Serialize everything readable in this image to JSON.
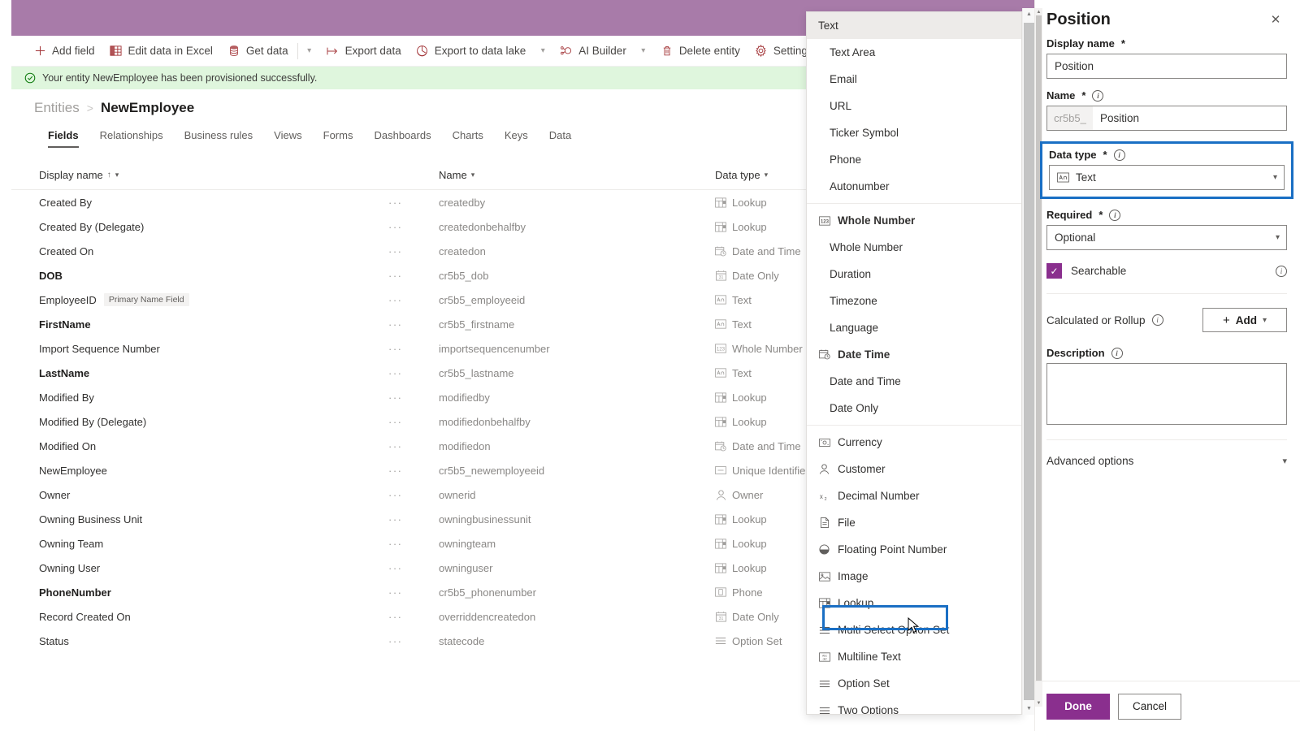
{
  "theme": {
    "accent": "#8a2f8e",
    "header_bar": "#a87ba9",
    "focus_outline": "#1a6fc4",
    "success_bg": "#dff6dd"
  },
  "commandbar": {
    "items": [
      {
        "label": "Add field",
        "icon": "plus-icon",
        "chevron": false
      },
      {
        "label": "Edit data in Excel",
        "icon": "excel-icon",
        "chevron": false
      },
      {
        "label": "Get data",
        "icon": "database-icon",
        "chevron": true
      },
      {
        "label": "Export data",
        "icon": "export-icon",
        "chevron": false
      },
      {
        "label": "Export to data lake",
        "icon": "datalake-icon",
        "chevron": true
      },
      {
        "label": "AI Builder",
        "icon": "ai-builder-icon",
        "chevron": true
      },
      {
        "label": "Delete entity",
        "icon": "trash-icon",
        "chevron": false
      },
      {
        "label": "Settings",
        "icon": "gear-icon",
        "chevron": false
      }
    ]
  },
  "notification": {
    "text": "Your entity NewEmployee has been provisioned successfully.",
    "icon": "success-check-icon"
  },
  "breadcrumb": {
    "root": "Entities",
    "separator": ">",
    "current": "NewEmployee"
  },
  "tabs": {
    "items": [
      "Fields",
      "Relationships",
      "Business rules",
      "Views",
      "Forms",
      "Dashboards",
      "Charts",
      "Keys",
      "Data"
    ],
    "active": "Fields"
  },
  "table": {
    "columns": {
      "display_name": "Display name",
      "name": "Name",
      "data_type": "Data type",
      "sort_indicator": "↑"
    },
    "rows": [
      {
        "display": "Created By",
        "bold": false,
        "badge": "",
        "name": "createdby",
        "type": "Lookup",
        "type_icon": "lookup-icon"
      },
      {
        "display": "Created By (Delegate)",
        "bold": false,
        "badge": "",
        "name": "createdonbehalfby",
        "type": "Lookup",
        "type_icon": "lookup-icon"
      },
      {
        "display": "Created On",
        "bold": false,
        "badge": "",
        "name": "createdon",
        "type": "Date and Time",
        "type_icon": "datetime-icon"
      },
      {
        "display": "DOB",
        "bold": true,
        "badge": "",
        "name": "cr5b5_dob",
        "type": "Date Only",
        "type_icon": "dateonly-icon"
      },
      {
        "display": "EmployeeID",
        "bold": false,
        "badge": "Primary Name Field",
        "name": "cr5b5_employeeid",
        "type": "Text",
        "type_icon": "text-icon"
      },
      {
        "display": "FirstName",
        "bold": true,
        "badge": "",
        "name": "cr5b5_firstname",
        "type": "Text",
        "type_icon": "text-icon"
      },
      {
        "display": "Import Sequence Number",
        "bold": false,
        "badge": "",
        "name": "importsequencenumber",
        "type": "Whole Number",
        "type_icon": "wholenumber-icon"
      },
      {
        "display": "LastName",
        "bold": true,
        "badge": "",
        "name": "cr5b5_lastname",
        "type": "Text",
        "type_icon": "text-icon"
      },
      {
        "display": "Modified By",
        "bold": false,
        "badge": "",
        "name": "modifiedby",
        "type": "Lookup",
        "type_icon": "lookup-icon"
      },
      {
        "display": "Modified By (Delegate)",
        "bold": false,
        "badge": "",
        "name": "modifiedonbehalfby",
        "type": "Lookup",
        "type_icon": "lookup-icon"
      },
      {
        "display": "Modified On",
        "bold": false,
        "badge": "",
        "name": "modifiedon",
        "type": "Date and Time",
        "type_icon": "datetime-icon"
      },
      {
        "display": "NewEmployee",
        "bold": false,
        "badge": "",
        "name": "cr5b5_newemployeeid",
        "type": "Unique Identifier",
        "type_icon": "uniqueid-icon"
      },
      {
        "display": "Owner",
        "bold": false,
        "badge": "",
        "name": "ownerid",
        "type": "Owner",
        "type_icon": "owner-icon"
      },
      {
        "display": "Owning Business Unit",
        "bold": false,
        "badge": "",
        "name": "owningbusinessunit",
        "type": "Lookup",
        "type_icon": "lookup-icon"
      },
      {
        "display": "Owning Team",
        "bold": false,
        "badge": "",
        "name": "owningteam",
        "type": "Lookup",
        "type_icon": "lookup-icon"
      },
      {
        "display": "Owning User",
        "bold": false,
        "badge": "",
        "name": "owninguser",
        "type": "Lookup",
        "type_icon": "lookup-icon"
      },
      {
        "display": "PhoneNumber",
        "bold": true,
        "badge": "",
        "name": "cr5b5_phonenumber",
        "type": "Phone",
        "type_icon": "phone-icon"
      },
      {
        "display": "Record Created On",
        "bold": false,
        "badge": "",
        "name": "overriddencreatedon",
        "type": "Date Only",
        "type_icon": "dateonly-icon"
      },
      {
        "display": "Status",
        "bold": false,
        "badge": "",
        "name": "statecode",
        "type": "Option Set",
        "type_icon": "optionset-icon"
      }
    ],
    "row_menu_glyph": "···"
  },
  "datatype_flyout": {
    "selected": "Text",
    "hovered": "Multi Select Option Set",
    "items": [
      {
        "label": "Text",
        "icon": "",
        "sub": false,
        "group": false,
        "selected": true
      },
      {
        "label": "Text Area",
        "icon": "",
        "sub": true,
        "group": false,
        "selected": false
      },
      {
        "label": "Email",
        "icon": "",
        "sub": true,
        "group": false,
        "selected": false
      },
      {
        "label": "URL",
        "icon": "",
        "sub": true,
        "group": false,
        "selected": false
      },
      {
        "label": "Ticker Symbol",
        "icon": "",
        "sub": true,
        "group": false,
        "selected": false
      },
      {
        "label": "Phone",
        "icon": "",
        "sub": true,
        "group": false,
        "selected": false
      },
      {
        "label": "Autonumber",
        "icon": "",
        "sub": true,
        "group": false,
        "selected": false
      },
      {
        "divider": true
      },
      {
        "label": "Whole Number",
        "icon": "wholenumber-icon",
        "sub": false,
        "group": true,
        "selected": false
      },
      {
        "label": "Whole Number",
        "icon": "",
        "sub": true,
        "group": false,
        "selected": false
      },
      {
        "label": "Duration",
        "icon": "",
        "sub": true,
        "group": false,
        "selected": false
      },
      {
        "label": "Timezone",
        "icon": "",
        "sub": true,
        "group": false,
        "selected": false
      },
      {
        "label": "Language",
        "icon": "",
        "sub": true,
        "group": false,
        "selected": false
      },
      {
        "label": "Date Time",
        "icon": "datetime-icon",
        "sub": false,
        "group": true,
        "selected": false
      },
      {
        "label": "Date and Time",
        "icon": "",
        "sub": true,
        "group": false,
        "selected": false
      },
      {
        "label": "Date Only",
        "icon": "",
        "sub": true,
        "group": false,
        "selected": false
      },
      {
        "divider": true
      },
      {
        "label": "Currency",
        "icon": "currency-icon",
        "sub": false,
        "group": false,
        "selected": false
      },
      {
        "label": "Customer",
        "icon": "customer-icon",
        "sub": false,
        "group": false,
        "selected": false
      },
      {
        "label": "Decimal Number",
        "icon": "decimal-icon",
        "sub": false,
        "group": false,
        "selected": false
      },
      {
        "label": "File",
        "icon": "file-icon",
        "sub": false,
        "group": false,
        "selected": false
      },
      {
        "label": "Floating Point Number",
        "icon": "float-icon",
        "sub": false,
        "group": false,
        "selected": false
      },
      {
        "label": "Image",
        "icon": "image-icon",
        "sub": false,
        "group": false,
        "selected": false
      },
      {
        "label": "Lookup",
        "icon": "lookup-icon",
        "sub": false,
        "group": false,
        "selected": false
      },
      {
        "label": "Multi Select Option Set",
        "icon": "optionset-icon",
        "sub": false,
        "group": false,
        "selected": false
      },
      {
        "label": "Multiline Text",
        "icon": "multiline-icon",
        "sub": false,
        "group": false,
        "selected": false
      },
      {
        "label": "Option Set",
        "icon": "optionset-icon",
        "sub": false,
        "group": false,
        "selected": false
      },
      {
        "label": "Two Options",
        "icon": "optionset-icon",
        "sub": false,
        "group": false,
        "selected": false
      }
    ]
  },
  "panel": {
    "title": "Position",
    "close_label": "✕",
    "display_name": {
      "label": "Display name",
      "required_mark": "*",
      "value": "Position"
    },
    "name": {
      "label": "Name",
      "required_mark": "*",
      "prefix": "cr5b5_",
      "value": "Position"
    },
    "data_type": {
      "label": "Data type",
      "required_mark": "*",
      "value": "Text",
      "icon": "text-icon"
    },
    "required": {
      "label": "Required",
      "required_mark": "*",
      "value": "Optional"
    },
    "searchable": {
      "label": "Searchable",
      "checked": true,
      "check_glyph": "✓"
    },
    "calculated": {
      "label": "Calculated or Rollup",
      "add_label": "Add",
      "plus": "+"
    },
    "description": {
      "label": "Description",
      "value": ""
    },
    "advanced": {
      "label": "Advanced options"
    },
    "footer": {
      "done": "Done",
      "cancel": "Cancel"
    }
  }
}
